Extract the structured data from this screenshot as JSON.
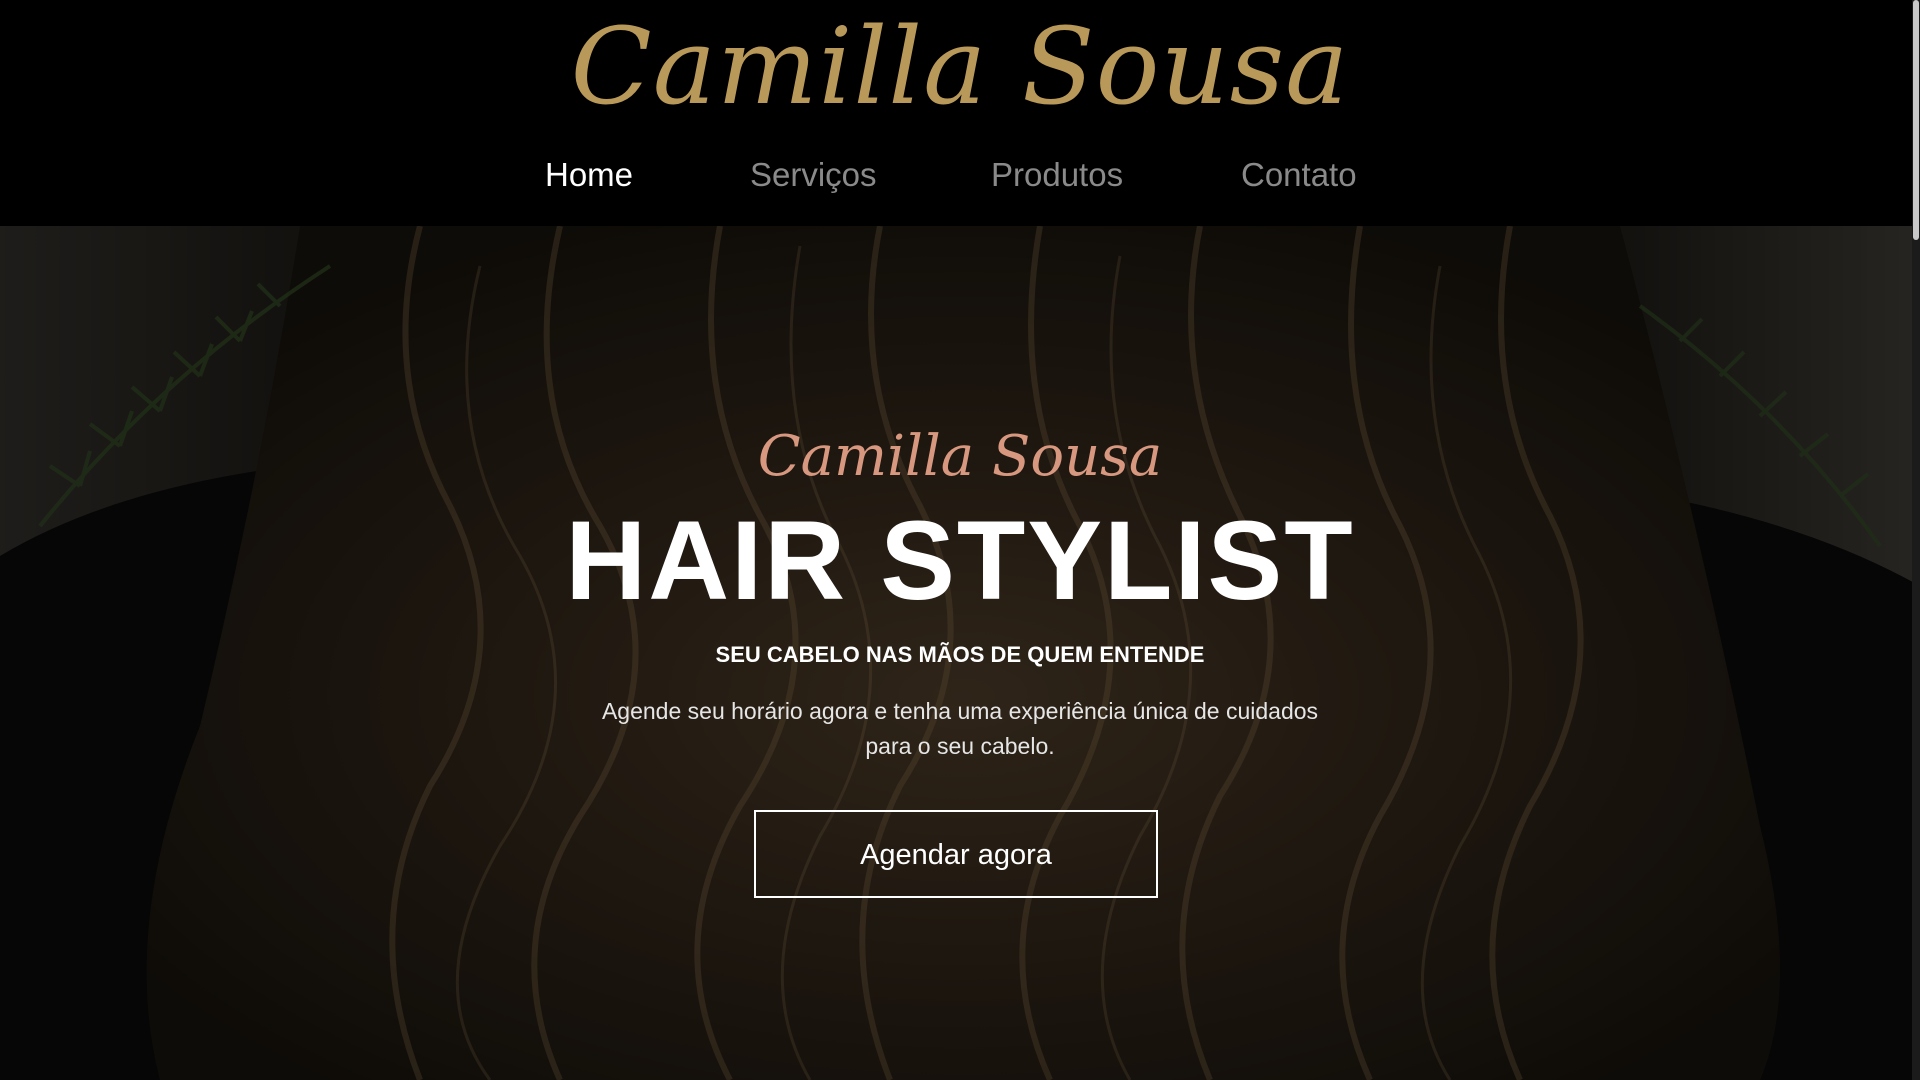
{
  "header": {
    "logo_text": "Camilla Sousa",
    "nav": [
      {
        "label": "Home",
        "active": true
      },
      {
        "label": "Serviços",
        "active": false
      },
      {
        "label": "Produtos",
        "active": false
      },
      {
        "label": "Contato",
        "active": false
      }
    ]
  },
  "hero": {
    "script_name": "Camilla Sousa",
    "title": "HAIR STYLIST",
    "tagline": "SEU CABELO NAS MÃOS DE QUEM ENTENDE",
    "description": "Agende seu horário agora e tenha uma experiência única de cuidados para o seu cabelo.",
    "cta_label": "Agendar agora"
  },
  "colors": {
    "logo_gold": "#b8995a",
    "script_rose": "#d89880",
    "nav_inactive": "#8a8a8a",
    "nav_active": "#ffffff",
    "header_bg": "#000000"
  }
}
